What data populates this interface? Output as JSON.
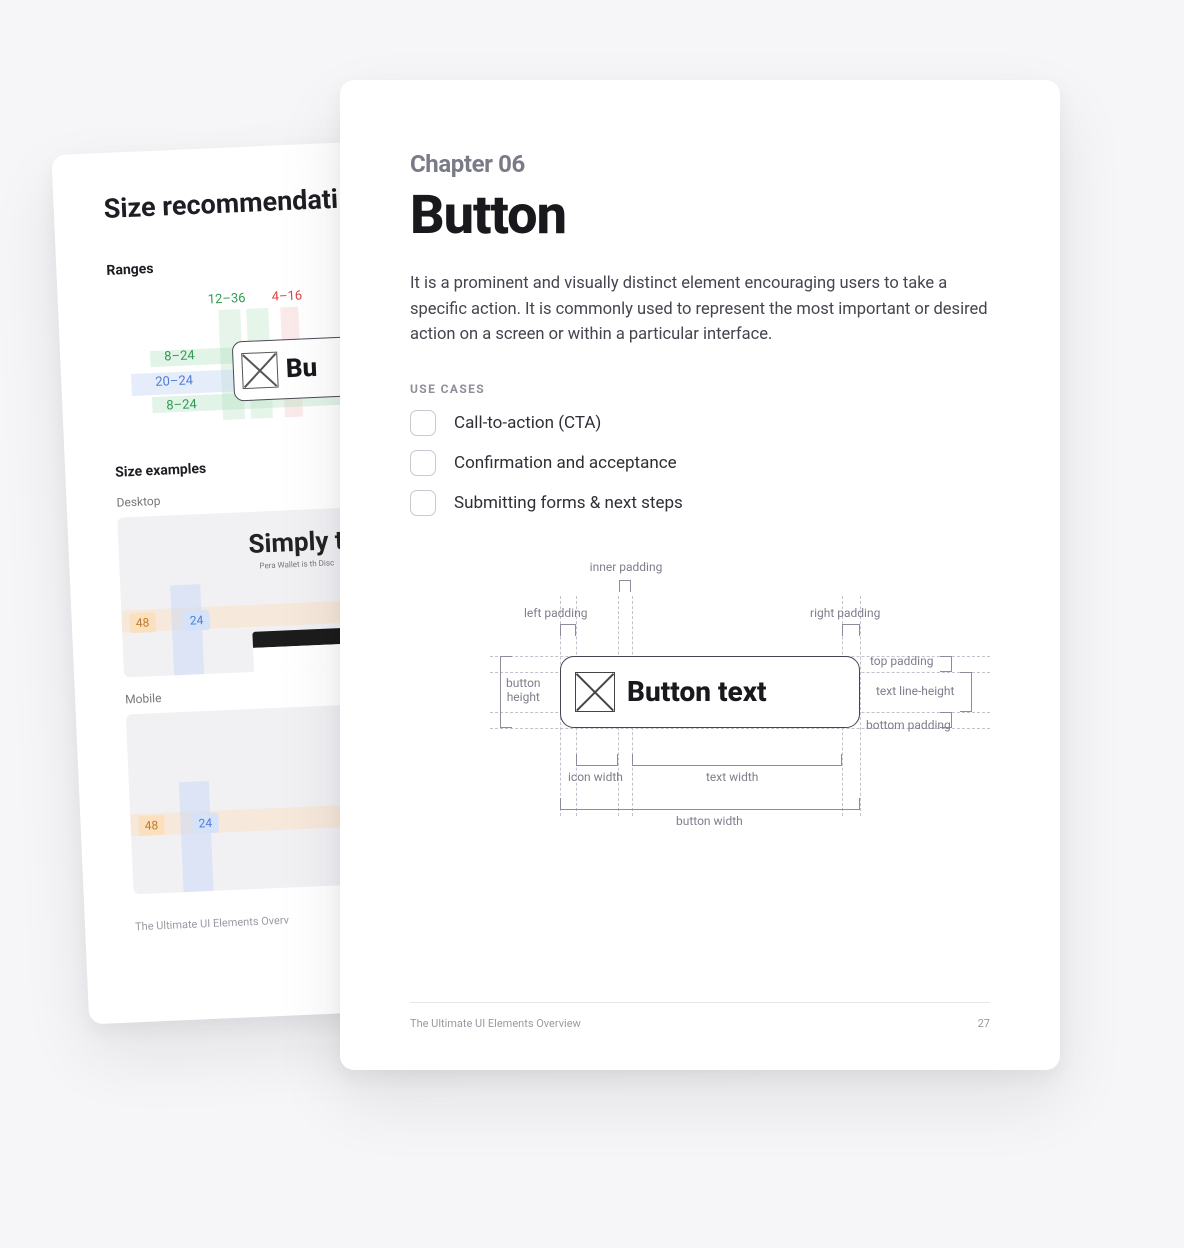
{
  "backPage": {
    "heading": "Size recommendati",
    "rangesLabel": "Ranges",
    "ranges": {
      "g1": "12–36",
      "r1": "4–16",
      "g2": "8–24",
      "b1": "20–24",
      "g3": "8–24"
    },
    "buttonPartial": "Bu",
    "sizeExamplesLabel": "Size examples",
    "desktopLabel": "Desktop",
    "desktopMock": {
      "title": "Simply t",
      "sub": "Pera Wallet is th\nDisc"
    },
    "pill48": "48",
    "pill24": "24",
    "mobileLabel": "Mobile",
    "footer": "The Ultimate UI Elements Overv"
  },
  "frontPage": {
    "chapter": "Chapter 06",
    "title": "Button",
    "description": "It is a prominent and visually distinct element encouraging users to take a specific action. It is commonly used to represent the most important or desired action on a screen or within a particular interface.",
    "useCasesLabel": "USE CASES",
    "useCases": [
      "Call-to-action (CTA)",
      "Confirmation and acceptance",
      "Submitting forms & next steps"
    ],
    "diagram": {
      "innerPadding": "inner padding",
      "leftPadding": "left padding",
      "rightPadding": "right padding",
      "buttonHeight": "button\nheight",
      "topPadding": "top padding",
      "textLineHeight": "text line-height",
      "bottomPadding": "bottom padding",
      "iconWidth": "icon width",
      "textWidth": "text width",
      "buttonWidth": "button width",
      "buttonText": "Button text"
    },
    "footerLeft": "The Ultimate UI Elements Overview",
    "pageNumber": "27"
  }
}
